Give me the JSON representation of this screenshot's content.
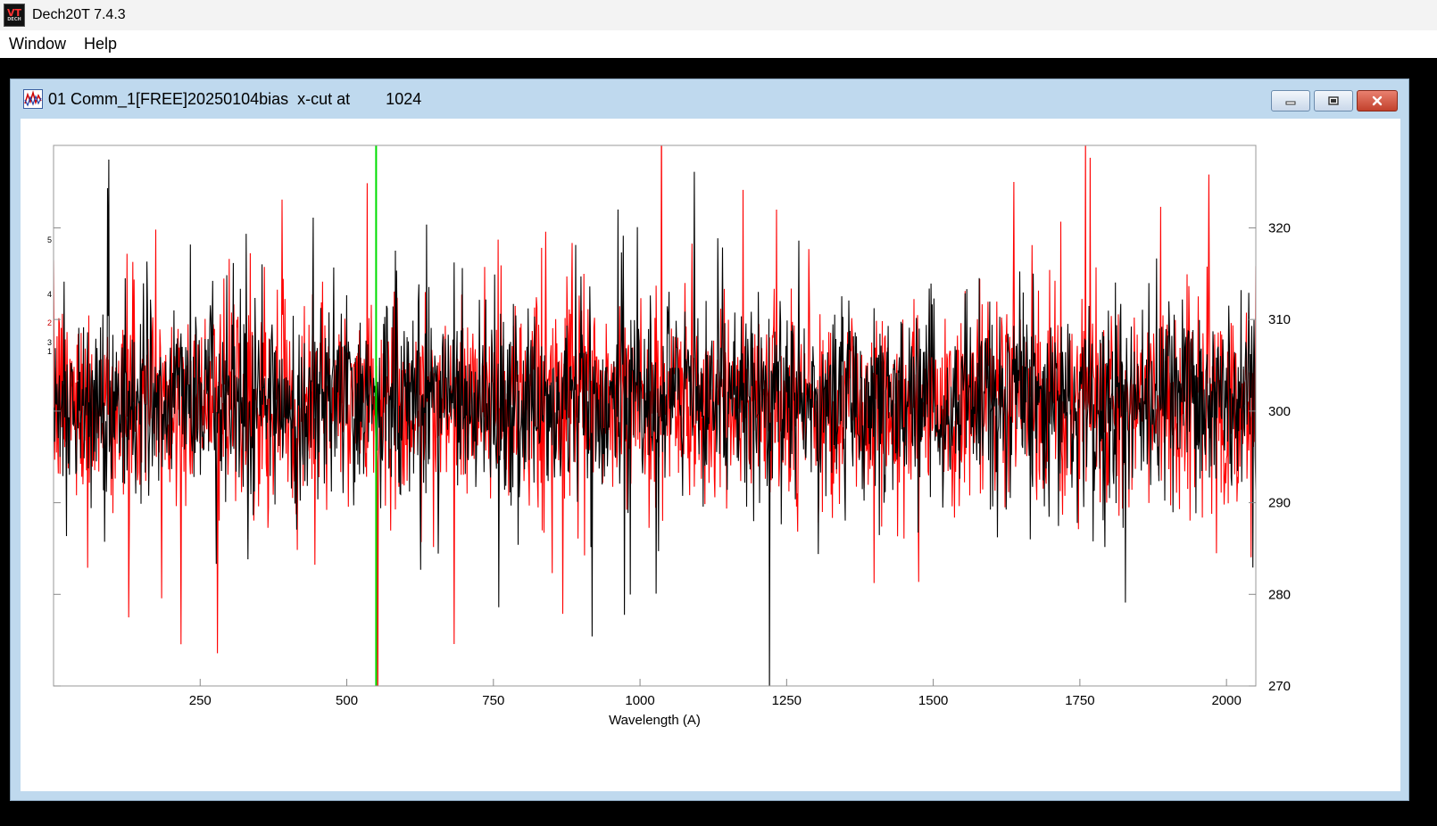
{
  "app": {
    "title": "Dech20T 7.4.3",
    "icon": "dech-app-icon",
    "icon_text": "VT",
    "icon_subtext": "DECH"
  },
  "menu": {
    "items": [
      "Window",
      "Help"
    ]
  },
  "child_window": {
    "title": "01 Comm_1[FREE]20250104bias  x-cut at        1024",
    "buttons": [
      "minimize-icon",
      "restore-icon",
      "close-icon"
    ],
    "active_color": "#bfd9ee"
  },
  "chart_data": {
    "type": "line",
    "xlabel": "Wavelength (A)",
    "xlim": [
      0,
      2050
    ],
    "ylim": [
      270,
      329
    ],
    "x_ticks": [
      250,
      500,
      750,
      1000,
      1250,
      1500,
      1750,
      2000
    ],
    "y_ticks": [
      270,
      280,
      290,
      300,
      310,
      320
    ],
    "cursor_x": 550,
    "series": [
      {
        "color": "#000000",
        "base": 301,
        "noise": 8.5,
        "points": 2048
      },
      {
        "color": "#ff0000",
        "base": 301,
        "noise": 9,
        "points": 2048
      }
    ],
    "cursor_color": "#00dd00",
    "left_axis_tick_labels": [
      "5",
      "4",
      "2",
      "3",
      "1"
    ]
  }
}
